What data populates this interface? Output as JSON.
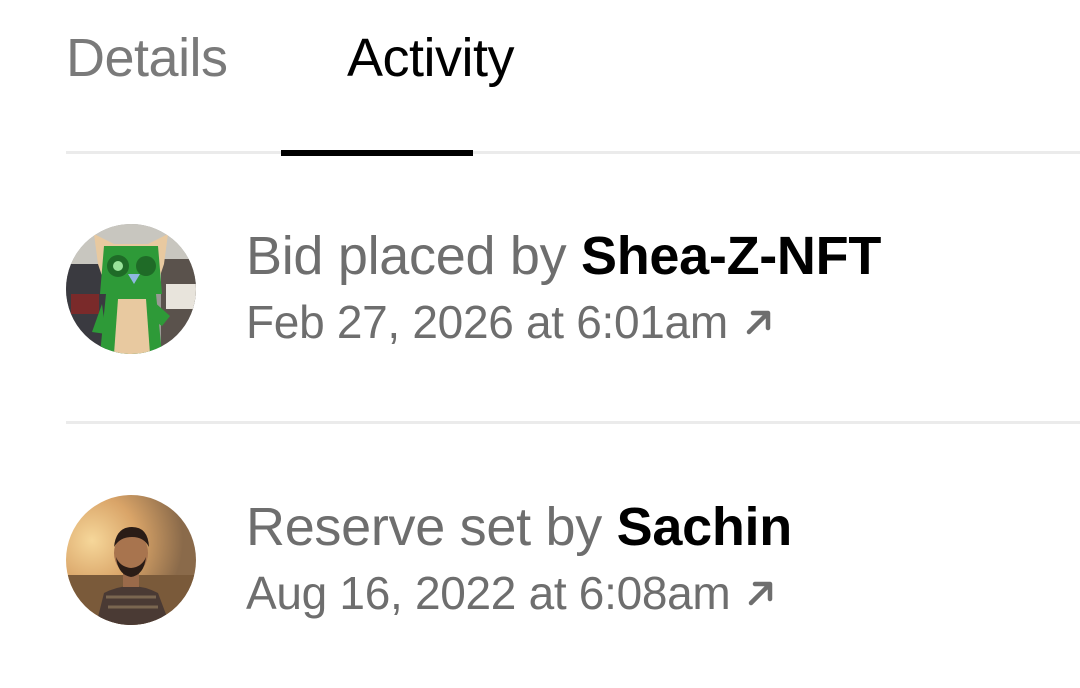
{
  "tabs": [
    {
      "label": "Details",
      "active": false
    },
    {
      "label": "Activity",
      "active": true
    }
  ],
  "activity": [
    {
      "action": "Bid placed by",
      "user": "Shea-Z-NFT",
      "date": "Feb 27, 2026 at 6:01am",
      "avatar_icon": "green-owl-avatar",
      "link_icon": "arrow-up-right-icon"
    },
    {
      "action": "Reserve set by",
      "user": "Sachin",
      "date": "Aug 16, 2022 at 6:08am",
      "avatar_icon": "user-photo-avatar",
      "link_icon": "arrow-up-right-icon"
    }
  ],
  "colors": {
    "active_tab": "#000000",
    "inactive_tab": "#7a7a7a",
    "secondary_text": "#6e6e6e",
    "divider": "#ebebeb",
    "background": "#ffffff"
  }
}
